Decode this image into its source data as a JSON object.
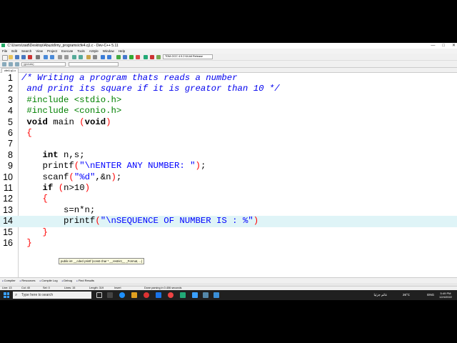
{
  "window": {
    "title": "C:\\Users\\zaid\\Desktop\\Abuzid\\my_programs\\cfe4.q1.c - Dev-C++ 5.11",
    "controls": [
      "—",
      "□",
      "✕"
    ]
  },
  "menu": [
    "File",
    "Edit",
    "Search",
    "View",
    "Project",
    "Execute",
    "Tools",
    "AStyle",
    "Window",
    "Help"
  ],
  "toolbar": {
    "compiler": "TDM-GCC 4.9.2 64-bit Release",
    "scope": "(globals)"
  },
  "tab": {
    "label": "cfe4.q1.c"
  },
  "editor": {
    "current_line": 13,
    "tooltip": "public int __cdecl printf (const char * __restrict__ _Format, ...)"
  },
  "bottom_tabs": [
    "Compiler",
    "Resources",
    "Compile Log",
    "Debug",
    "Find Results"
  ],
  "status": {
    "line": "Line: 13",
    "col": "Col: 40",
    "sel": "Sel: 0",
    "lines": "Lines: 15",
    "length": "Length: 319",
    "mode": "Insert",
    "message": "Done parsing in 0.406 seconds"
  },
  "taskbar": {
    "search_placeholder": "Type here to search",
    "weather": "26°C",
    "arabic": "غائم جزئيا",
    "lang": "ENG",
    "time": "5:49 PM",
    "date": "12/4/2022"
  },
  "colors": {
    "comment": "#0000ee",
    "preprocessor": "#008000",
    "string": "#0000ff",
    "bracket": "#ff0000",
    "current_line": "#dff4f7"
  }
}
